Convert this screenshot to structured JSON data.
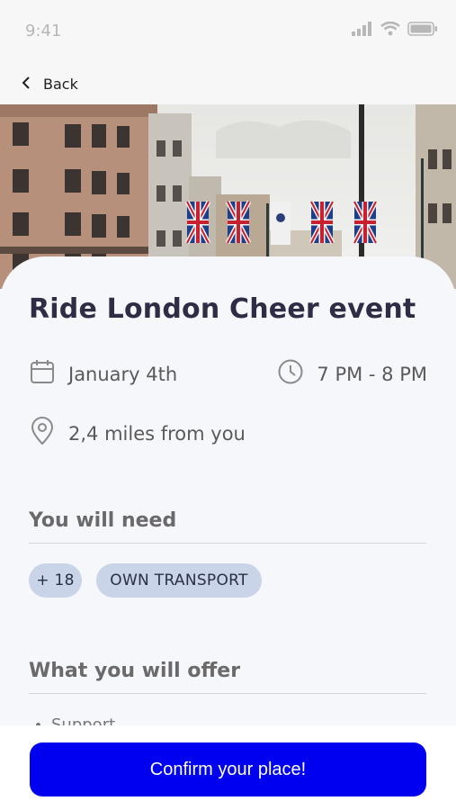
{
  "status": {
    "time": "9:41"
  },
  "nav": {
    "back_label": "Back"
  },
  "event": {
    "title": "Ride London Cheer event",
    "date": "January 4th",
    "time": "7 PM - 8 PM",
    "distance": "2,4 miles from you"
  },
  "need": {
    "heading": "You will need",
    "chips": [
      "+ 18",
      "OWN TRANSPORT"
    ]
  },
  "offer": {
    "heading": "What you will offer",
    "items": [
      "Support"
    ]
  },
  "cta": {
    "label": "Confirm your place!"
  },
  "colors": {
    "cta": "#0000f0",
    "chip": "#c9d4e8",
    "title": "#2f2c45"
  },
  "icons": [
    "back-chevron-icon",
    "calendar-icon",
    "clock-icon",
    "location-pin-icon",
    "signal-icon",
    "wifi-icon",
    "battery-icon"
  ]
}
